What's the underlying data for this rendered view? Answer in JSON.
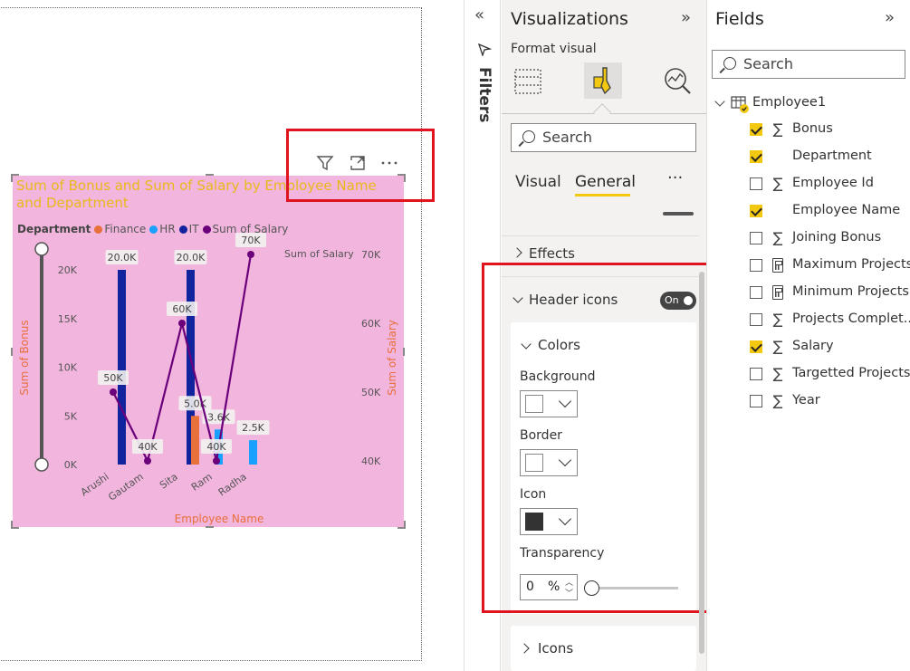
{
  "chart": {
    "title": "Sum of Bonus and Sum of Salary by Employee Name and Department",
    "legend_title": "Department",
    "legend": [
      {
        "label": "Finance",
        "color": "#e8703a"
      },
      {
        "label": "HR",
        "color": "#1aa0ff"
      },
      {
        "label": "IT",
        "color": "#12239e"
      },
      {
        "label": "Sum of Salary",
        "color": "#6b007b"
      }
    ],
    "y_left_label": "Sum of Bonus",
    "y_right_label": "Sum of Salary",
    "y_right_title": "Sum of Salary",
    "x_label": "Employee Name",
    "y_left_ticks": [
      "0K",
      "5K",
      "10K",
      "15K",
      "20K"
    ],
    "y_right_ticks": [
      "40K",
      "50K",
      "60K",
      "70K"
    ],
    "header_icons": [
      "filter-icon",
      "focus-mode-icon",
      "more-options-icon"
    ]
  },
  "chart_data": {
    "type": "bar",
    "title": "Sum of Bonus and Sum of Salary by Employee Name and Department",
    "xlabel": "Employee Name",
    "ylabel": "Sum of Bonus",
    "y2label": "Sum of Salary",
    "ylim": [
      0,
      20000
    ],
    "y2lim": [
      40000,
      70000
    ],
    "legend_position": "top-left",
    "categories": [
      "Arushi",
      "Gautam",
      "Sita",
      "Ram",
      "Radha"
    ],
    "series": [
      {
        "name": "IT",
        "color": "#12239e",
        "values": [
          20000,
          0,
          20000,
          0,
          0
        ],
        "labels": [
          "20.0K",
          "",
          "20.0K",
          "",
          ""
        ]
      },
      {
        "name": "Finance",
        "color": "#e8703a",
        "values": [
          0,
          0,
          5000,
          0,
          0
        ],
        "labels": [
          "",
          "",
          "5.0K",
          "",
          ""
        ]
      },
      {
        "name": "HR",
        "color": "#1aa0ff",
        "values": [
          0,
          0,
          0,
          3600,
          2500
        ],
        "labels": [
          "",
          "",
          "",
          "3.6K",
          "2.5K"
        ]
      },
      {
        "name": "Sum of Salary",
        "type": "line",
        "axis": "right",
        "color": "#6b007b",
        "points": [
          {
            "x": "Arushi",
            "y": 50000,
            "label": "50K"
          },
          {
            "x": "Gautam",
            "y": 40000,
            "label": "40K"
          },
          {
            "x": "Sita",
            "y": 60000,
            "label": "60K"
          },
          {
            "x": "Ram",
            "y": 40000,
            "label": "40K"
          },
          {
            "x": "Radha",
            "y": 70000,
            "label": "70K"
          }
        ]
      }
    ]
  },
  "filters": {
    "label": "Filters"
  },
  "viz": {
    "title": "Visualizations",
    "subtitle": "Format visual",
    "search_placeholder": "Search",
    "tabs": [
      "Visual",
      "General"
    ],
    "more": "···",
    "effects": "Effects",
    "header_icons": "Header icons",
    "toggle": "On",
    "colors": "Colors",
    "background": "Background",
    "border": "Border",
    "icon": "Icon",
    "transparency": "Transparency",
    "transparency_value": "0",
    "percent": "%",
    "icons": "Icons",
    "swatch_background": "#ffffff",
    "swatch_border": "#ffffff",
    "swatch_icon": "#333333"
  },
  "fields": {
    "title": "Fields",
    "search_placeholder": "Search",
    "table": "Employee1",
    "items": [
      {
        "label": "Bonus",
        "checked": true,
        "icon": "sum"
      },
      {
        "label": "Department",
        "checked": true,
        "icon": "none"
      },
      {
        "label": "Employee Id",
        "checked": false,
        "icon": "sum"
      },
      {
        "label": "Employee Name",
        "checked": true,
        "icon": "none"
      },
      {
        "label": "Joining Bonus",
        "checked": false,
        "icon": "sum"
      },
      {
        "label": "Maximum Projects",
        "checked": false,
        "icon": "calc"
      },
      {
        "label": "Minimum Projects",
        "checked": false,
        "icon": "calc"
      },
      {
        "label": "Projects Complet...",
        "checked": false,
        "icon": "sum"
      },
      {
        "label": "Salary",
        "checked": true,
        "icon": "sum"
      },
      {
        "label": "Targetted Projects",
        "checked": false,
        "icon": "sum"
      },
      {
        "label": "Year",
        "checked": false,
        "icon": "sum"
      }
    ]
  }
}
